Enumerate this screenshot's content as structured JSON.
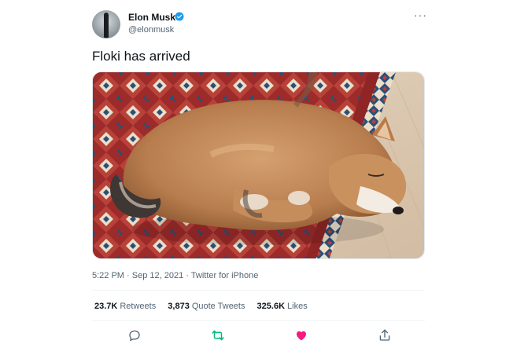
{
  "author": {
    "name": "Elon Musk",
    "handle": "@elonmusk",
    "verified": true
  },
  "tweet": {
    "text": "Floki has arrived",
    "timestamp": "5:22 PM · Sep 12, 2021 · Twitter for iPhone"
  },
  "stats": {
    "retweets_count": "23.7K",
    "retweets_label": "Retweets",
    "quotes_count": "3,873",
    "quotes_label": "Quote Tweets",
    "likes_count": "325.6K",
    "likes_label": "Likes"
  },
  "actions": [
    "reply-icon",
    "retweet-icon",
    "like-icon",
    "share-icon"
  ],
  "colors": {
    "verified": "#1d9bf0",
    "retweet": "#00ba7c",
    "like": "#f91880",
    "muted": "#536471"
  }
}
